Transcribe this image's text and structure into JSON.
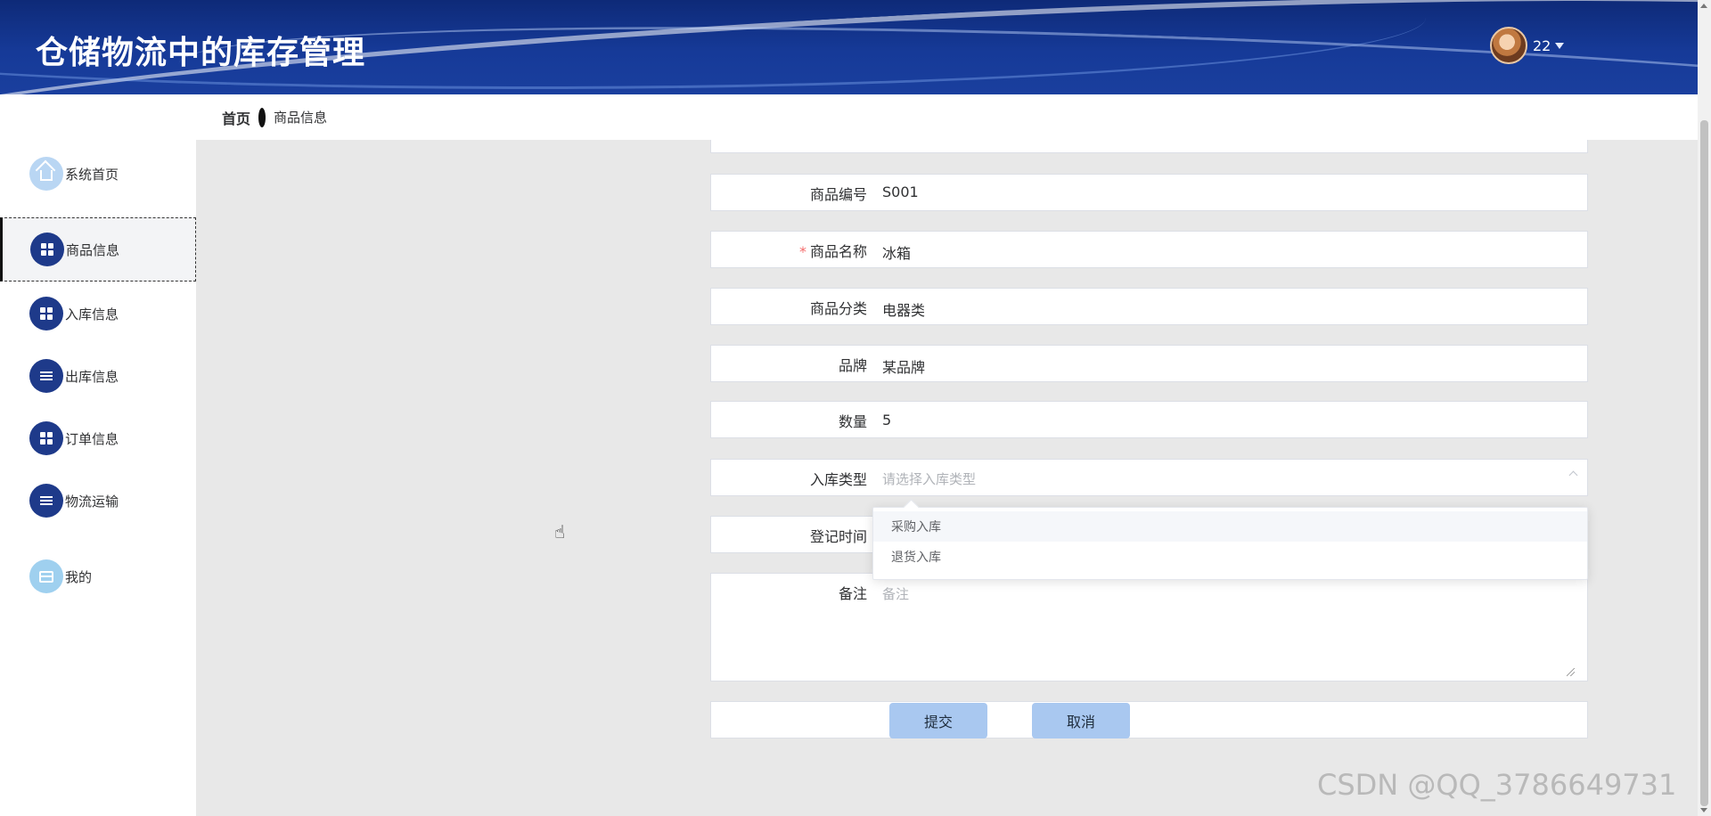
{
  "header": {
    "title": "仓储物流中的库存管理",
    "username": "22"
  },
  "sidebar": {
    "items": [
      {
        "label": "系统首页",
        "icon": "home-icon"
      },
      {
        "label": "商品信息",
        "icon": "grid-icon",
        "active": true
      },
      {
        "label": "入库信息",
        "icon": "grid-icon"
      },
      {
        "label": "出库信息",
        "icon": "list-icon"
      },
      {
        "label": "订单信息",
        "icon": "grid-icon"
      },
      {
        "label": "物流运输",
        "icon": "list-icon"
      },
      {
        "label": "我的",
        "icon": "card-icon"
      }
    ]
  },
  "breadcrumb": {
    "home": "首页",
    "current": "商品信息"
  },
  "form": {
    "code_label": "商品编号",
    "code_value": "S001",
    "name_required": "*",
    "name_label": "商品名称",
    "name_value": "冰箱",
    "category_label": "商品分类",
    "category_value": "电器类",
    "brand_label": "品牌",
    "brand_value": "某品牌",
    "quantity_label": "数量",
    "quantity_value": "5",
    "intype_label": "入库类型",
    "intype_placeholder": "请选择入库类型",
    "regtime_label": "登记时间",
    "remark_label": "备注",
    "remark_placeholder": "备注",
    "submit_label": "提交",
    "cancel_label": "取消"
  },
  "dropdown": {
    "options": [
      "采购入库",
      "退货入库"
    ]
  },
  "watermark": "CSDN @QQ_3786649731",
  "colors": {
    "header": "#163a98",
    "accent": "#1e3a8a",
    "button": "#a9c8f0",
    "main_bg": "#e8e8e8"
  }
}
